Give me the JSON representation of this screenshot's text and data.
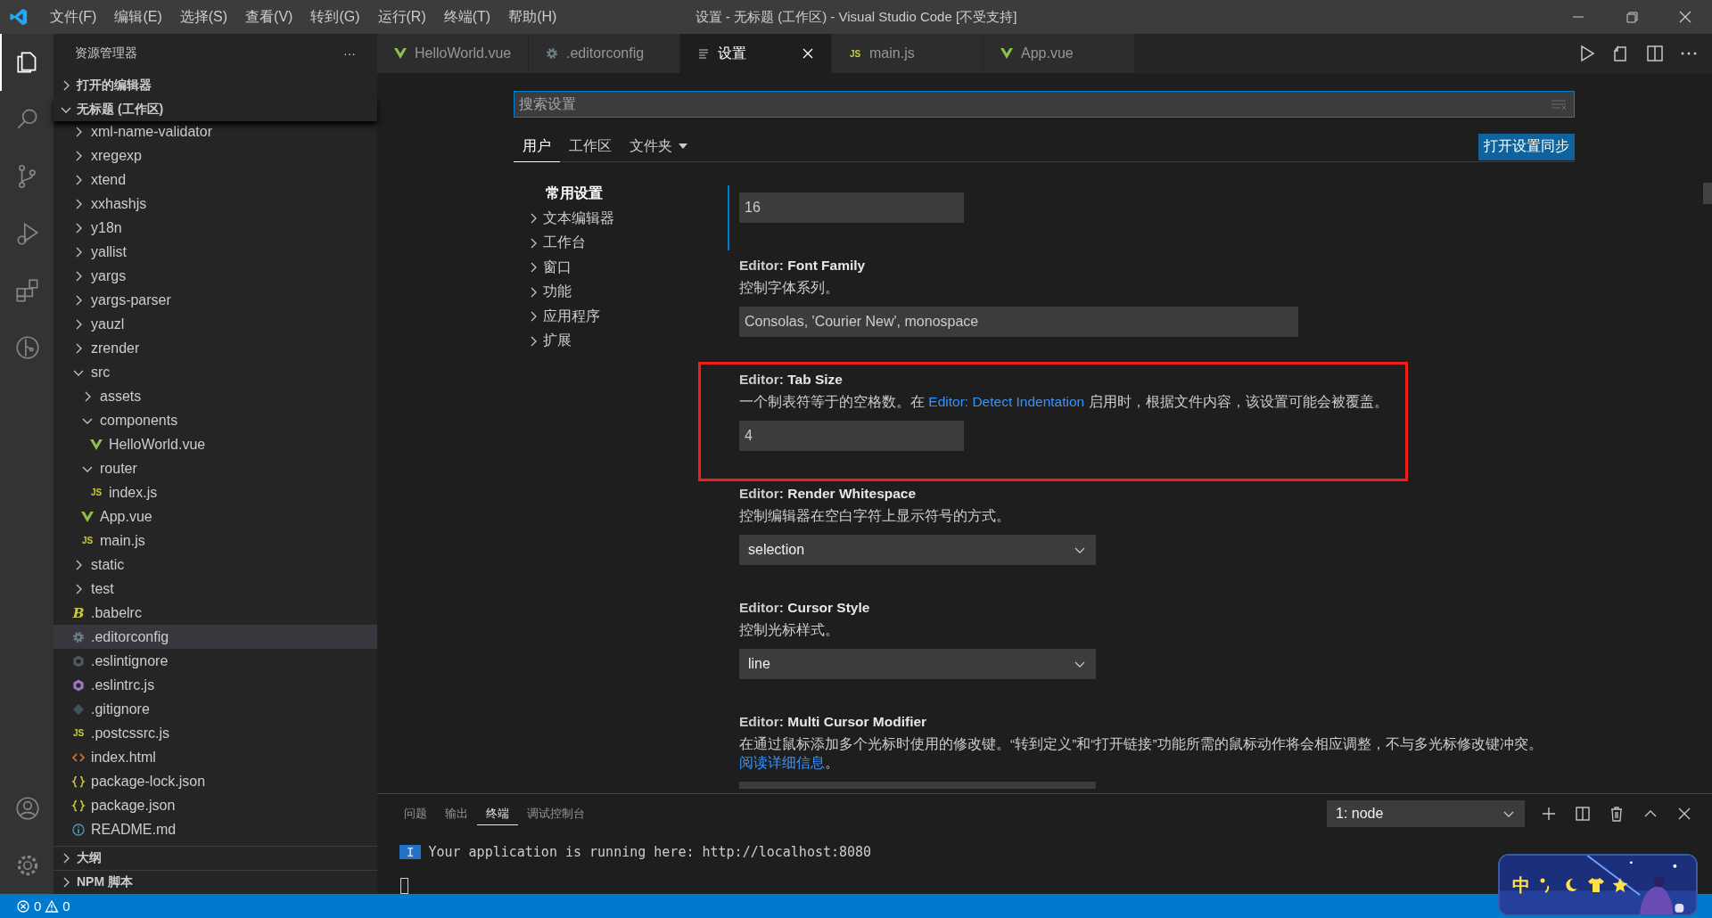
{
  "window": {
    "title": "设置 - 无标题 (工作区) - Visual Studio Code [不受支持]"
  },
  "menu": [
    "文件(F)",
    "编辑(E)",
    "选择(S)",
    "查看(V)",
    "转到(G)",
    "运行(R)",
    "终端(T)",
    "帮助(H)"
  ],
  "activity_bar": [
    {
      "kind": "explorer",
      "selected": true
    },
    {
      "kind": "search",
      "selected": false
    },
    {
      "kind": "source-control",
      "selected": false
    },
    {
      "kind": "run",
      "selected": false
    },
    {
      "kind": "extensions",
      "selected": false
    },
    {
      "kind": "git-graph",
      "selected": false
    }
  ],
  "activity_bar_bottom": [
    {
      "kind": "account"
    },
    {
      "kind": "settings"
    }
  ],
  "sidebar": {
    "title": "资源管理器",
    "more": "···",
    "sections": [
      {
        "label": "打开的编辑器",
        "expanded": false
      },
      {
        "label": "无标题 (工作区)",
        "expanded": true
      }
    ],
    "tree": [
      {
        "children": [
          {
            "name": "xml-name-validator",
            "kind": "folder",
            "expanded": false,
            "selected": false
          },
          {
            "name": "xregexp",
            "kind": "folder",
            "expanded": false,
            "selected": false
          },
          {
            "name": "xtend",
            "kind": "folder",
            "expanded": false,
            "selected": false
          },
          {
            "name": "xxhashjs",
            "kind": "folder",
            "expanded": false,
            "selected": false
          },
          {
            "name": "y18n",
            "kind": "folder",
            "expanded": false,
            "selected": false
          },
          {
            "name": "yallist",
            "kind": "folder",
            "expanded": false,
            "selected": false
          },
          {
            "name": "yargs",
            "kind": "folder",
            "expanded": false,
            "selected": false
          },
          {
            "name": "yargs-parser",
            "kind": "folder",
            "expanded": false,
            "selected": false
          },
          {
            "name": "yauzl",
            "kind": "folder",
            "expanded": false,
            "selected": false
          },
          {
            "name": "zrender",
            "kind": "folder",
            "expanded": false,
            "selected": false
          }
        ]
      },
      {
        "name": "src",
        "kind": "folder",
        "expanded": true,
        "selected": false,
        "children": [
          {
            "name": "assets",
            "kind": "folder",
            "expanded": false,
            "selected": false
          },
          {
            "name": "components",
            "kind": "folder",
            "expanded": true,
            "selected": false,
            "children": [
              {
                "name": "HelloWorld.vue",
                "kind": "vue",
                "selected": false
              }
            ]
          },
          {
            "name": "router",
            "kind": "folder",
            "expanded": true,
            "selected": false,
            "children": [
              {
                "name": "index.js",
                "kind": "js",
                "icon_text": "JS",
                "selected": false
              }
            ]
          },
          {
            "name": "App.vue",
            "kind": "vue",
            "selected": false
          },
          {
            "name": "main.js",
            "kind": "js",
            "icon_text": "JS",
            "selected": false
          }
        ]
      },
      {
        "name": "static",
        "kind": "folder",
        "expanded": false,
        "selected": false
      },
      {
        "name": "test",
        "kind": "folder",
        "expanded": false,
        "selected": false
      },
      {
        "name": ".babelrc",
        "kind": "babel",
        "icon_text": "B",
        "selected": false
      },
      {
        "name": ".editorconfig",
        "kind": "gear",
        "selected": true
      },
      {
        "name": ".eslintignore",
        "kind": "eslint-grey",
        "selected": false
      },
      {
        "name": ".eslintrc.js",
        "kind": "eslint",
        "selected": false
      },
      {
        "name": ".gitignore",
        "kind": "git",
        "selected": false
      },
      {
        "name": ".postcssrc.js",
        "kind": "js",
        "icon_text": "JS",
        "selected": false
      },
      {
        "name": "index.html",
        "kind": "html",
        "selected": false
      },
      {
        "name": "package-lock.json",
        "kind": "json",
        "selected": false
      },
      {
        "name": "package.json",
        "kind": "json",
        "selected": false
      },
      {
        "name": "README.md",
        "kind": "info",
        "selected": false
      }
    ],
    "bottom_sections": [
      {
        "label": "大纲",
        "expanded": false
      },
      {
        "label": "NPM 脚本",
        "expanded": false
      }
    ]
  },
  "editor_tabs": [
    {
      "label": "HelloWorld.vue",
      "kind": "vue",
      "selected": false
    },
    {
      "label": ".editorconfig",
      "kind": "gear",
      "selected": false
    },
    {
      "label": "设置",
      "kind": "lines",
      "selected": true
    },
    {
      "label": "main.js",
      "kind": "js",
      "icon_text": "JS",
      "selected": false
    },
    {
      "label": "App.vue",
      "kind": "vue",
      "selected": false
    }
  ],
  "settings": {
    "search": {
      "placeholder": "搜索设置"
    },
    "scope_tabs": [
      {
        "label": "用户",
        "selected": true
      },
      {
        "label": "工作区",
        "selected": false
      },
      {
        "label": "文件夹",
        "selected": false,
        "dropdown": true
      }
    ],
    "sync_button": "打开设置同步",
    "toc": [
      {
        "label": "常用设置",
        "expanded": true,
        "selected": true
      },
      {
        "label": "文本编辑器",
        "expanded": false,
        "selected": false
      },
      {
        "label": "工作台",
        "expanded": false,
        "selected": false
      },
      {
        "label": "窗口",
        "expanded": false,
        "selected": false
      },
      {
        "label": "功能",
        "expanded": false,
        "selected": false
      },
      {
        "label": "应用程序",
        "expanded": false,
        "selected": false
      },
      {
        "label": "扩展",
        "expanded": false,
        "selected": false
      }
    ],
    "items": [
      {
        "kind": "number",
        "value": "16",
        "focused": true,
        "highlighted": false
      },
      {
        "kind": "text",
        "category": "Editor:",
        "label": "Font Family",
        "description": [
          {
            "kind": "text",
            "text": "控制字体系列。"
          }
        ],
        "value": "Consolas, 'Courier New', monospace",
        "focused": false,
        "highlighted": false
      },
      {
        "kind": "number",
        "category": "Editor:",
        "label": "Tab Size",
        "description": [
          {
            "kind": "text",
            "text": "一个制表符等于的空格数。在 "
          },
          {
            "kind": "link",
            "text": "Editor: Detect Indentation"
          },
          {
            "kind": "text",
            "text": " 启用时，根据文件内容，该设置可能会被覆盖。"
          }
        ],
        "value": "4",
        "focused": false,
        "highlighted": true
      },
      {
        "kind": "select",
        "category": "Editor:",
        "label": "Render Whitespace",
        "description": [
          {
            "kind": "text",
            "text": "控制编辑器在空白字符上显示符号的方式。"
          }
        ],
        "value": "selection",
        "focused": false,
        "highlighted": false
      },
      {
        "kind": "select",
        "category": "Editor:",
        "label": "Cursor Style",
        "description": [
          {
            "kind": "text",
            "text": "控制光标样式。"
          }
        ],
        "value": "line",
        "focused": false,
        "highlighted": false
      },
      {
        "kind": "cut",
        "category": "Editor:",
        "label": "Multi Cursor Modifier",
        "description": [
          {
            "kind": "text",
            "text": "在通过鼠标添加多个光标时使用的修改键。“转到定义”和“打开链接”功能所需的鼠标动作将会相应调整，不与多光标修改键冲突。"
          },
          {
            "kind": "link",
            "text": "阅读详细信息"
          },
          {
            "kind": "text",
            "text": "。"
          }
        ],
        "focused": false,
        "highlighted": false
      }
    ]
  },
  "panel": {
    "tabs": [
      {
        "label": "问题",
        "selected": false
      },
      {
        "label": "输出",
        "selected": false
      },
      {
        "label": "终端",
        "selected": true
      },
      {
        "label": "调试控制台",
        "selected": false
      }
    ],
    "terminal_select": "1: node",
    "terminal": {
      "badge": "I",
      "line": "Your application is running here: http://localhost:8080"
    }
  },
  "ime": {
    "mode": "中"
  },
  "status_bar": {
    "errors": "0",
    "warnings": "0"
  }
}
